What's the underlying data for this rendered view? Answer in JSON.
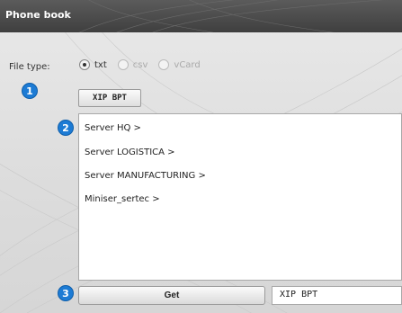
{
  "window": {
    "title": "Phone book"
  },
  "file_type": {
    "label": "File type:",
    "options": [
      {
        "label": "txt",
        "selected": true,
        "enabled": true
      },
      {
        "label": "csv",
        "selected": false,
        "enabled": false
      },
      {
        "label": "vCard",
        "selected": false,
        "enabled": false
      }
    ]
  },
  "badges": {
    "one": "1",
    "two": "2",
    "three": "3"
  },
  "xip_button": {
    "label": "XIP BPT"
  },
  "server_list": {
    "items": [
      "Server HQ >",
      "Server LOGISTICA >",
      "Server MANUFACTURING >",
      "Miniser_sertec >"
    ]
  },
  "get_button": {
    "label": "Get"
  },
  "get_field": {
    "value": "XIP BPT"
  },
  "colors": {
    "badge": "#1d7bd4",
    "titlebar": "#4a4a4a"
  }
}
